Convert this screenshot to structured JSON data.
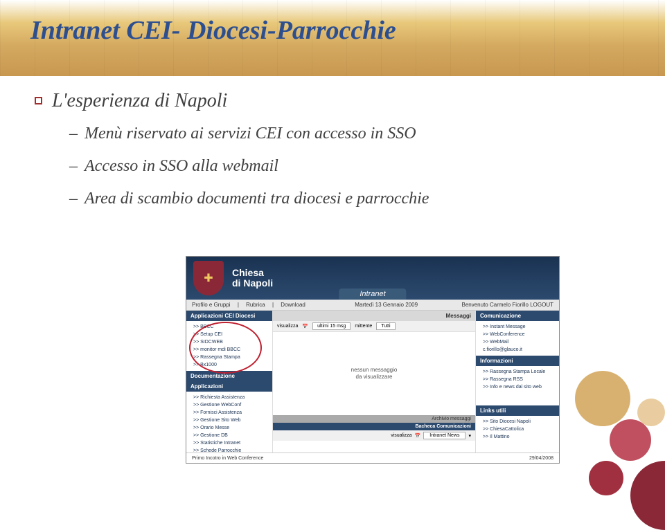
{
  "slide": {
    "title": "Intranet CEI- Diocesi-Parrocchie",
    "bullet_main": "L'esperienza di Napoli",
    "sub1": "Menù riservato ai servizi CEI con accesso in SSO",
    "sub2": "Accesso in SSO alla webmail",
    "sub3": "Area di scambio documenti tra diocesi e parrocchie"
  },
  "intranet": {
    "brand_line1": "Chiesa",
    "brand_line2": "di Napoli",
    "intranet_label": "Intranet",
    "nav": {
      "profilo": "Profilo e Gruppi",
      "rubrica": "Rubrica",
      "download": "Download",
      "date": "Martedì 13 Gennaio 2009",
      "welcome": "Benvenuto Carmelo Fiorillo",
      "logout": "LOGOUT"
    },
    "left": {
      "applicazioni_cei": "Applicazioni CEI Diocesi",
      "items_cei": [
        ">> BBCC",
        ">> Setup CEI",
        ">> SIDCWEB",
        ">> monitor mdi BBCC",
        ">> Rassegna Stampa",
        ">> Bx1000"
      ],
      "documentazione": "Documentazione",
      "applicazioni": "Applicazioni",
      "items_app": [
        ">> Richiesta Assistenza",
        ">> Gestione WebConf",
        ">> Fornisci Assistenza",
        ">> Gestione Sito Web",
        ">> Orario Messe",
        ">> Gestione DB",
        ">> Statistiche Intranet",
        ">> Schede Parrocchie"
      ]
    },
    "mid": {
      "messaggi": "Messaggi",
      "visualizza": "visualizza",
      "ultimi": "ultimi 15 msg",
      "mittente": "mittente",
      "tutti": "Tutti",
      "no_msg_line1": "nessun messaggio",
      "no_msg_line2": "da visualizzare",
      "archivio": "Archivio messaggi",
      "bacheca": "Bacheca Comunicazioni",
      "intranet_news": "Intranet News"
    },
    "right": {
      "comunicazione": "Comunicazione",
      "items_com": [
        ">> Instant Message",
        ">> WebConference",
        ">> WebMail",
        "    c.fiorillo@glauco.it"
      ],
      "informazioni": "Informazioni",
      "items_info": [
        ">> Rassegna Stampa Locale",
        ">> Rassegna RSS",
        ">> Info e news dal sito web"
      ],
      "links": "Links utili",
      "items_links": [
        ">> Sito Diocesi Napoli",
        ">> ChiesaCattolica",
        ">> Il Mattino"
      ]
    },
    "footer": {
      "left": "Primo Incotro in Web Conference",
      "right": "29/04/2008"
    }
  }
}
